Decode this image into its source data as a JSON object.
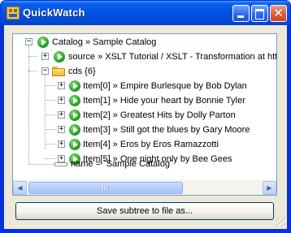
{
  "window": {
    "title": "QuickWatch"
  },
  "tree": {
    "root": {
      "label": "Catalog » Sample Catalog",
      "expander": "−"
    },
    "source": {
      "label": "source » XSLT Tutorial / XSLT - Transformation at http",
      "expander": "+"
    },
    "cds": {
      "label": "cds {6}",
      "expander": "−",
      "items": [
        {
          "label": "Item[0] » Empire Burlesque by Bob Dylan",
          "expander": "+"
        },
        {
          "label": "Item[1] » Hide your heart by Bonnie Tyler",
          "expander": "+"
        },
        {
          "label": "Item[2] » Greatest Hits by Dolly Parton",
          "expander": "+"
        },
        {
          "label": "Item[3] » Still got the blues by Gary Moore",
          "expander": "+"
        },
        {
          "label": "Item[4] » Eros by Eros Ramazzotti",
          "expander": "+"
        },
        {
          "label": "Item[5] » One night only by Bee Gees",
          "expander": "+"
        }
      ]
    },
    "name_attr": {
      "label": "name = `Sample Catalog`"
    }
  },
  "scrollbar": {
    "left_arrow": "◀",
    "right_arrow": "▶"
  },
  "actions": {
    "save_label": "Save subtree to file as..."
  },
  "titlebar_buttons": {
    "close_glyph": "✕"
  },
  "colors": {
    "titlebar": "#0054e3",
    "client_bg": "#ece9d8",
    "tree_border": "#7f9db9",
    "play_icon": "#2fa52a",
    "folder": "#e8b838"
  }
}
